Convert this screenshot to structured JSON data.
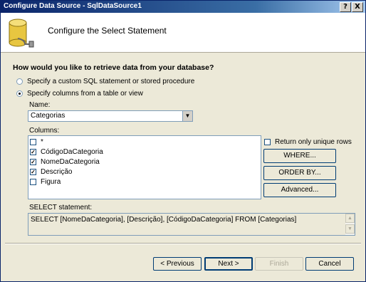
{
  "window": {
    "title": "Configure Data Source - SqlDataSource1"
  },
  "title_buttons": {
    "help": "?",
    "close": "X"
  },
  "header": {
    "title": "Configure the Select Statement"
  },
  "question": "How would you like to retrieve data from your database?",
  "options": {
    "custom": "Specify a custom SQL statement or stored procedure",
    "columns": "Specify columns from a table or view"
  },
  "name_label": "Name:",
  "name_value": "Categorias",
  "columns_label": "Columns:",
  "columns": [
    {
      "label": "*",
      "checked": false
    },
    {
      "label": "CódigoDaCategoria",
      "checked": true
    },
    {
      "label": "NomeDaCategoria",
      "checked": true
    },
    {
      "label": "Descrição",
      "checked": true
    },
    {
      "label": "Figura",
      "checked": false
    }
  ],
  "unique_rows_label": "Return only unique rows",
  "side_buttons": {
    "where": "WHERE...",
    "order_by": "ORDER BY...",
    "advanced": "Advanced..."
  },
  "sql_label": "SELECT statement:",
  "sql_text": "SELECT [NomeDaCategoria], [Descrição], [CódigoDaCategoria] FROM [Categorias]",
  "nav_buttons": {
    "previous": "< Previous",
    "next": "Next >",
    "finish": "Finish",
    "cancel": "Cancel"
  }
}
